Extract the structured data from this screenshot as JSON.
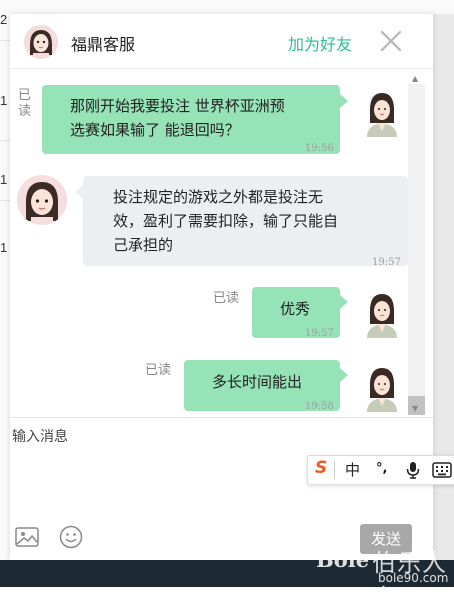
{
  "background_list": {
    "numbers": [
      "2",
      "1",
      "1",
      "1"
    ]
  },
  "header": {
    "contact_name": "福鼎客服",
    "add_friend_label": "加为好友",
    "close_icon": "close-icon"
  },
  "messages": [
    {
      "side": "me",
      "read_label": "已读",
      "text_lines": [
        "那刚开始我要投注 世界杯亚洲预",
        "选赛如果输了 能退回吗？"
      ],
      "time": "19:56"
    },
    {
      "side": "them",
      "text_lines": [
        "投注规定的游戏之外都是投注无",
        "效，盈利了需要扣除，输了只能自",
        "己承担的"
      ],
      "time": "19:57"
    },
    {
      "side": "me",
      "read_label": "已读",
      "text_lines": [
        "优秀"
      ],
      "time": "19:57"
    },
    {
      "side": "me",
      "read_label": "已读",
      "text_lines": [
        "多长时间能出"
      ],
      "time": "19:58"
    }
  ],
  "input": {
    "placeholder": "输入消息",
    "send_label": "发送",
    "image_icon": "image-icon",
    "emoji_icon": "emoji-icon"
  },
  "ime_toolbar": {
    "logo": "S",
    "mode": "中",
    "punct": "°,",
    "mic_icon": "microphone-icon",
    "keyboard_icon": "keyboard-icon"
  },
  "watermark": {
    "logo": "Bole",
    "name": "伯乐人家",
    "url": "bole90.com"
  },
  "colors": {
    "my_bubble": "#96e3b8",
    "their_bubble": "#eceef2",
    "accent": "#2fbf8f",
    "send_button": "#a8a8a8"
  }
}
